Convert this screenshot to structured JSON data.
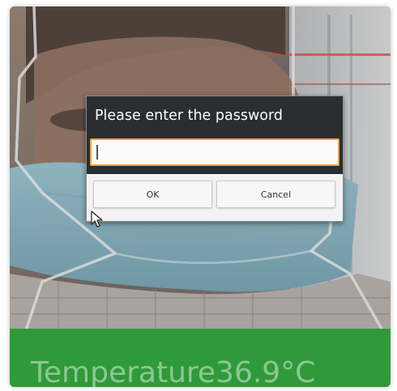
{
  "dialog": {
    "title": "Please enter the password",
    "password_value": "",
    "ok_label": "OK",
    "cancel_label": "Cancel"
  },
  "status_bar": {
    "temperature_text": "Temperature36.9°C",
    "color": "#2f9a39"
  },
  "colors": {
    "dialog_background": "#2a2d31",
    "input_focus_border": "#f2a43a",
    "button_area": "#f3f3f3"
  },
  "icons": {
    "pointer": "mouse-cursor-icon"
  }
}
